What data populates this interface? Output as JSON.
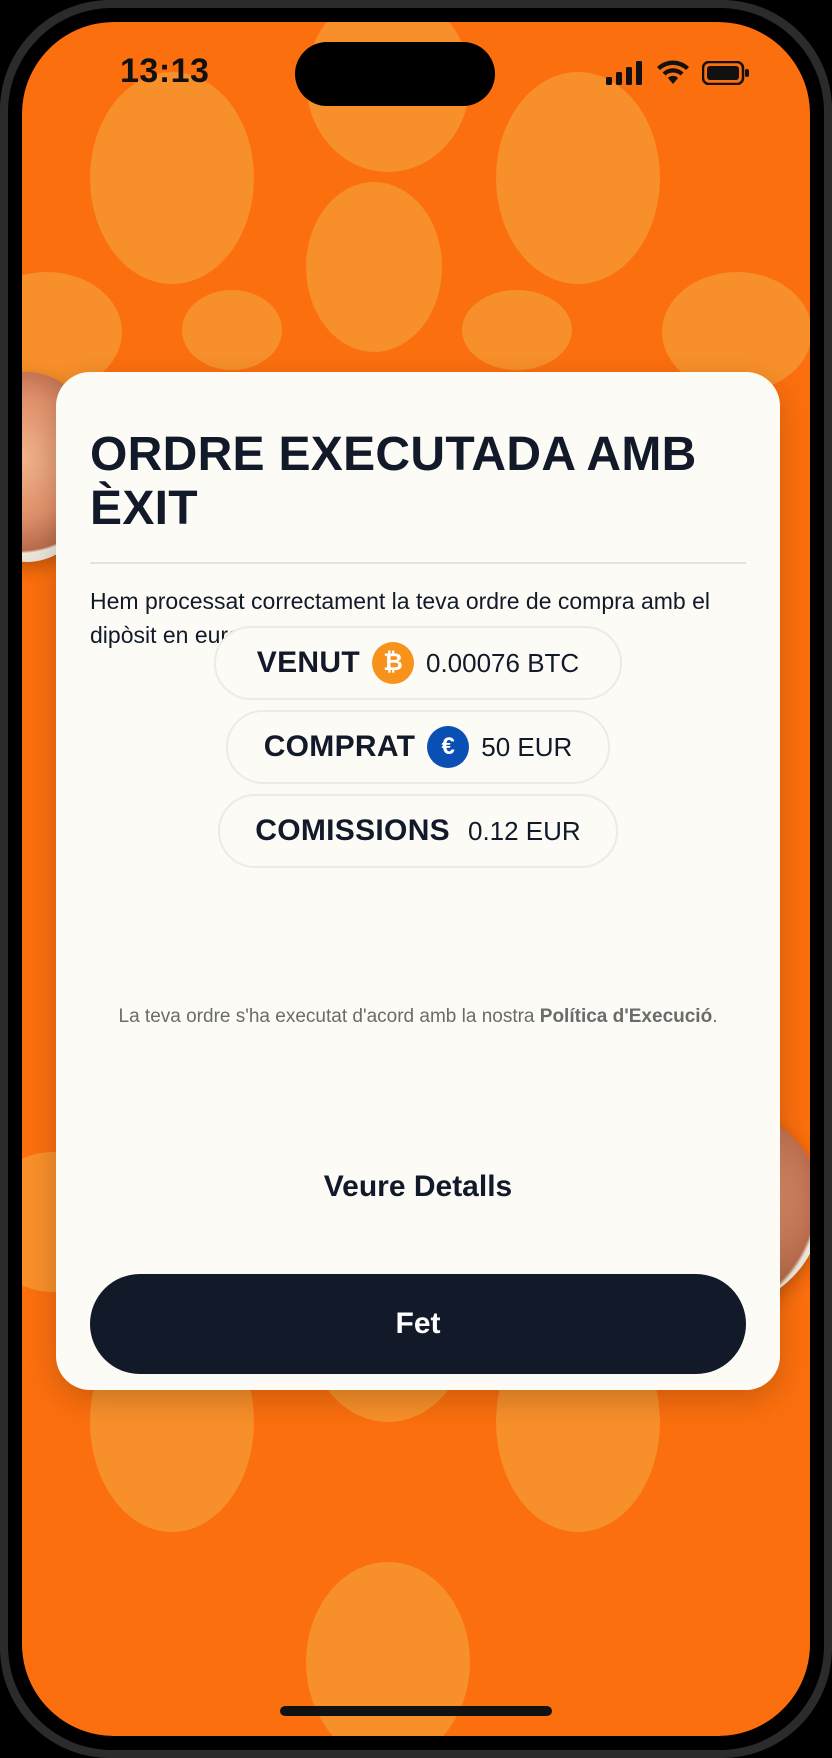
{
  "status_bar": {
    "time": "13:13"
  },
  "dialog": {
    "title": "ORDRE EXECUTADA AMB ÈXIT",
    "description": "Hem processat correctament la teva ordre de compra amb el dipòsit en euros que rebem recentment.",
    "rows": [
      {
        "label": "VENUT",
        "icon": "bitcoin-icon",
        "value": "0.00076 BTC"
      },
      {
        "label": "COMPRAT",
        "icon": "euro-icon",
        "value": "50 EUR"
      },
      {
        "label": "COMISSIONS",
        "value": "0.12 EUR"
      }
    ],
    "policy_text": "La teva ordre s'ha executat d'acord amb la nostra ",
    "policy_link": "Política d'Execució",
    "policy_end": ".",
    "details_label": "Veure Detalls",
    "done_label": "Fet"
  },
  "colors": {
    "background": "#fb6f0e",
    "blob": "#f7902c",
    "primary": "#121a2a",
    "bitcoin": "#f7931a",
    "euro": "#0a4fb3"
  }
}
